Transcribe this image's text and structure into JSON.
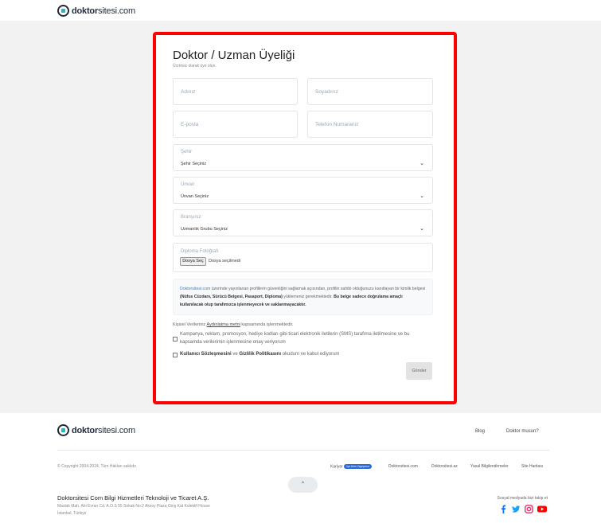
{
  "brand": {
    "logo_bold": "doktor",
    "logo_rest": "sitesi.com"
  },
  "form": {
    "title": "Doktor / Uzman Üyeliği",
    "subtitle": "Ücretsiz olarak üye olun.",
    "name_placeholder": "Adınız",
    "surname_placeholder": "Soyadınız",
    "email_placeholder": "E-posta",
    "phone_placeholder": "Telefon Numaranız",
    "city": {
      "label": "Şehir",
      "value": "Şehir Seçiniz"
    },
    "title_field": {
      "label": "Ünvan",
      "value": "Ünvan Seçiniz"
    },
    "branch": {
      "label": "Branşınız",
      "value": "Uzmanlık Grubu Seçiniz"
    },
    "diploma": {
      "label": "Diploma Fotoğrafı",
      "button": "Dosya Seç",
      "status": "Dosya seçilmedi"
    },
    "notice": {
      "link": "Doktorsitesi.com",
      "part1": " üzerinde yayınlanan profillerin güvenliğini sağlamak açısından, profilin sahibi olduğunuzu kanıtlayan bir kimlik belgesi ",
      "bold1": "(Nüfus Cüzdanı, Sürücü Belgesi, Pasaport, Diploma)",
      "part2": " yüklemeniz gerekmektedir. ",
      "bold2": "Bu belge sadece doğrulama amaçlı kullanılacak olup tarafımızca işlenmeyecek ve saklanmayacaktır."
    },
    "kvkk_prefix": "Kişisel Verileriniz ",
    "kvkk_link": "Aydınlatma metni",
    "kvkk_suffix": " kapsamında işlenmektedir.",
    "consent_sms": "Kampanya, reklam, promosyon, hediye kodları gibi ticari elektronik iletilerin (SMS) tarafıma iletilmesine ve bu kapsamda verilerimin işlenmesine onay veriyorum",
    "consent_terms_b1": "Kullanıcı Sözleşmesini",
    "consent_terms_mid": " ve ",
    "consent_terms_b2": "Gizlilik Politikasını",
    "consent_terms_end": " okudum ve kabul ediyorum",
    "submit": "Gönder"
  },
  "footer": {
    "nav": [
      "Blog",
      "Doktor musun?"
    ],
    "copyright": "© Copyright 2004-2024, Tüm Hakları saklıdır.",
    "links": {
      "kariyer": "Kariyer",
      "badge": "İşe Alım Yapıyoruz",
      "l1": "Doktorsitesi.com",
      "l2": "Doktorsitesi.az",
      "l3": "Yasal Bilgilendirmeler",
      "l4": "Site Haritası"
    },
    "company": "Doktorsitesi Com Bilgi Hizmetleri Teknoloji ve Ticaret A.Ş.",
    "address1": "Maslak Mah. Ahi Evran Cd. A.O.S 55 Sokak No:2 Aksoy Plaza Giriş Kat Kolektif House",
    "address2": "İstanbul, Türkiye",
    "social_title": "Sosyal medyada bizi takip et",
    "social": [
      "facebook-icon",
      "twitter-icon",
      "instagram-icon",
      "youtube-icon"
    ]
  },
  "colors": {
    "highlight": "#ff0000",
    "link": "#3d7fd1",
    "brand_teal": "#26b5c2",
    "brand_dark": "#1f2b3a"
  }
}
